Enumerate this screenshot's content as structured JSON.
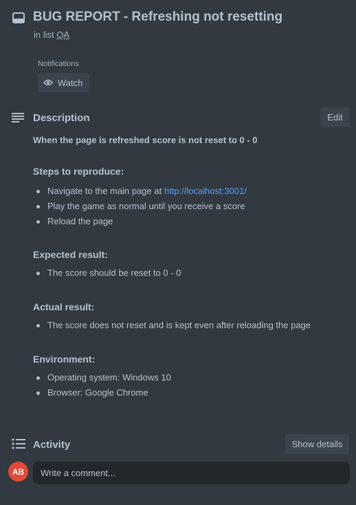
{
  "card": {
    "title": "BUG REPORT - Refreshing not resetting",
    "in_list_prefix": "in list",
    "list_name": "QA"
  },
  "notifications": {
    "label": "Notifications",
    "watch_label": "Watch"
  },
  "description": {
    "heading": "Description",
    "edit_label": "Edit",
    "summary": "When the page is refreshed score is not reset to 0 - 0",
    "steps_heading": "Steps to reproduce:",
    "steps": [
      {
        "text": "Navigate to the main page at ",
        "link": "http://localhost:3001/"
      },
      {
        "text": "Play the game as normal until you receive a score"
      },
      {
        "text": "Reload the page"
      }
    ],
    "expected_heading": "Expected result:",
    "expected": [
      "The score should be reset to 0 - 0"
    ],
    "actual_heading": "Actual result:",
    "actual": [
      "The score does not reset and is kept even after reloading the page"
    ],
    "environment_heading": "Environment:",
    "environment": [
      "Operating system: Windows 10",
      "Browser: Google Chrome"
    ]
  },
  "activity": {
    "heading": "Activity",
    "show_details_label": "Show details",
    "avatar_initials": "AB",
    "comment_placeholder": "Write a comment..."
  },
  "colors": {
    "background": "#323940",
    "button": "#3b444c",
    "link": "#579dff",
    "avatar": "#e34935",
    "comment_box": "#22272b"
  }
}
